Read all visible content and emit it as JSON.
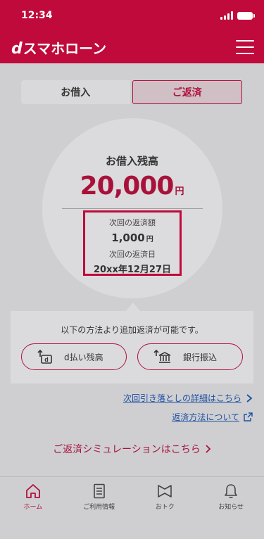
{
  "status_bar": {
    "time": "12:34"
  },
  "header": {
    "logo_d": "d",
    "logo_text": "スマホローン"
  },
  "tabs": [
    {
      "label": "お借入"
    },
    {
      "label": "ご返済"
    }
  ],
  "balance": {
    "title": "お借入残高",
    "amount": "20,000",
    "unit": "円"
  },
  "next_payment": {
    "amount_label": "次回の返済額",
    "amount": "1,000",
    "unit": "円",
    "date_label": "次回の返済日",
    "date": "20xx年12月27日"
  },
  "extra_payment": {
    "text": "以下の方法より追加返済が可能です。",
    "dpay_label": "d払い残高",
    "bank_label": "銀行振込"
  },
  "links": {
    "withdrawal_details": "次回引き落としの詳細はこちら",
    "repayment_methods": "返済方法について",
    "simulation": "ご返済シミュレーションはこちら"
  },
  "bottom_nav": [
    {
      "label": "ホーム"
    },
    {
      "label": "ご利用情報"
    },
    {
      "label": "おトク"
    },
    {
      "label": "お知らせ"
    }
  ],
  "colors": {
    "brand": "#c00a3b",
    "link": "#1c4fa0",
    "overlay_bg": "#cfcfd2"
  },
  "icons": [
    "menu-icon",
    "d-payment-icon",
    "bank-icon",
    "chevron-right-icon",
    "external-link-icon",
    "home-icon",
    "document-icon",
    "flag-icon",
    "bell-icon"
  ]
}
